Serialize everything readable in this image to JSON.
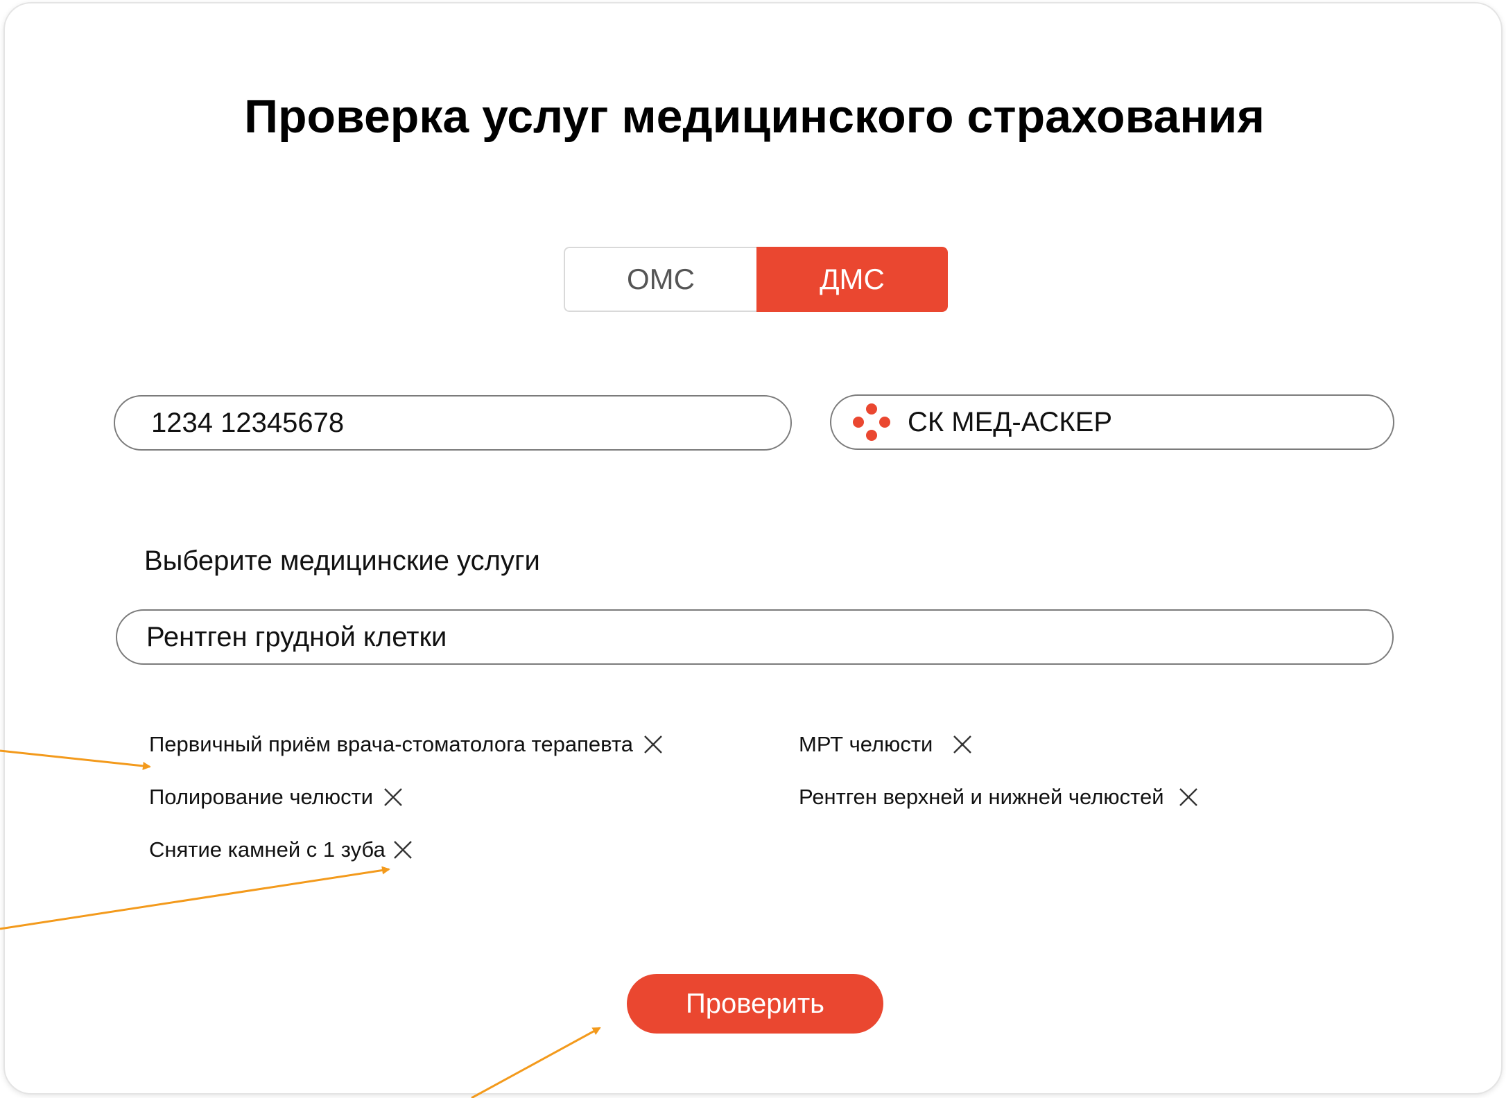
{
  "title": "Проверка услуг медицинского страхования",
  "insurance_type": {
    "options": [
      "ОМС",
      "ДМС"
    ],
    "selected": "ДМС"
  },
  "policy_number": {
    "value": "1234 12345678"
  },
  "company": {
    "value": "СК МЕД-АСКЕР"
  },
  "services": {
    "label": "Выберите медицинские услуги",
    "input_value": "Рентген грудной клетки",
    "selected": [
      "Первичный приём врача-стоматолога терапевта",
      "Полирование челюсти",
      "Снятие камней с 1 зуба",
      "МРТ челюсти",
      "Рентген верхней и нижней челюстей"
    ]
  },
  "check_button": {
    "label": "Проверить"
  },
  "colors": {
    "accent": "#ea4730",
    "annotation_arrow": "#f39a1c"
  },
  "icons": {
    "company_logo": "five-dot-cross-logo",
    "remove": "close-icon"
  }
}
